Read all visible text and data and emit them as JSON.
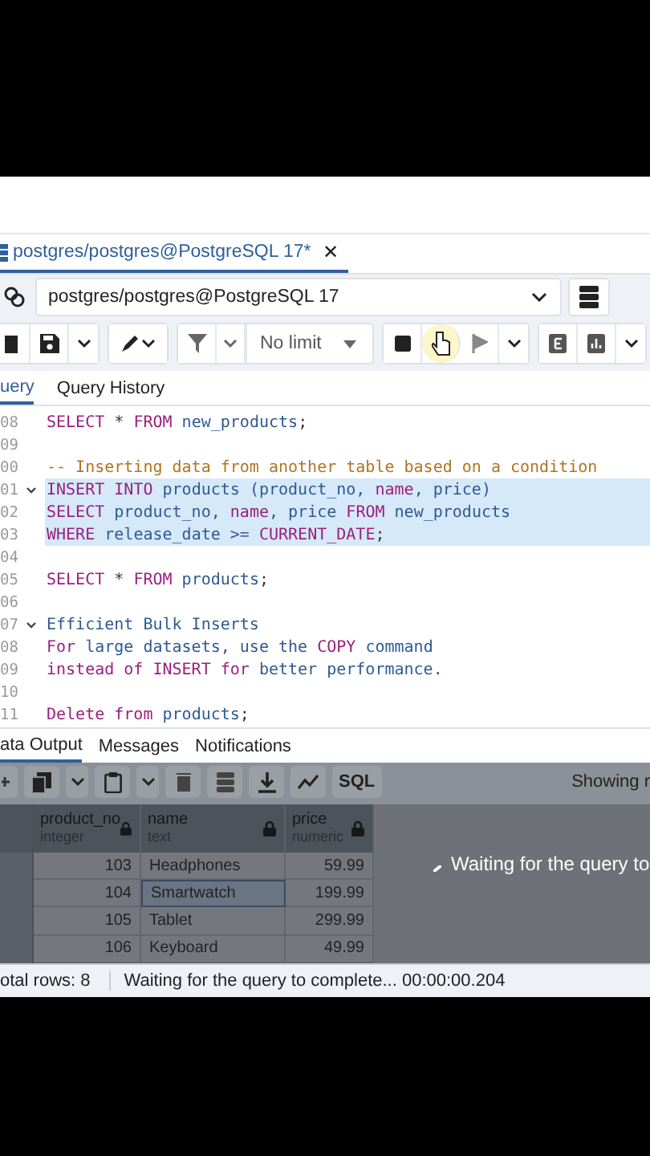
{
  "editor_tab": {
    "title": "postgres/postgres@PostgreSQL 17*",
    "close": "✕"
  },
  "connection": {
    "value": "postgres/postgres@PostgreSQL 17"
  },
  "toolbar": {
    "limit": "No limit"
  },
  "query_tabs": [
    {
      "label": "uery",
      "selected": true
    },
    {
      "label": "Query History",
      "selected": false
    }
  ],
  "code_lines": [
    {
      "number": "08",
      "selected": false,
      "foldable": false,
      "tokens": [
        {
          "text": "SELECT",
          "kind": "keyword"
        },
        {
          "text": " * ",
          "kind": "plain"
        },
        {
          "text": "FROM",
          "kind": "keyword"
        },
        {
          "text": " new_products",
          "kind": "ident"
        },
        {
          "text": ";",
          "kind": "plain"
        }
      ]
    },
    {
      "number": "09",
      "selected": false,
      "foldable": false
    },
    {
      "number": "00",
      "selected": false,
      "foldable": false,
      "tokens": [
        {
          "text": "-- Inserting data from another table based on a condition",
          "kind": "comment"
        }
      ]
    },
    {
      "number": "01",
      "selected": true,
      "foldable": true,
      "tokens": [
        {
          "text": "INSERT INTO",
          "kind": "keyword"
        },
        {
          "text": " products (product_no, ",
          "kind": "ident"
        },
        {
          "text": "name",
          "kind": "keyword"
        },
        {
          "text": ", price)",
          "kind": "ident"
        }
      ]
    },
    {
      "number": "02",
      "selected": true,
      "foldable": false,
      "tokens": [
        {
          "text": "SELECT",
          "kind": "keyword"
        },
        {
          "text": " product_no, ",
          "kind": "ident"
        },
        {
          "text": "name",
          "kind": "keyword"
        },
        {
          "text": ", price ",
          "kind": "ident"
        },
        {
          "text": "FROM",
          "kind": "keyword"
        },
        {
          "text": " new_products",
          "kind": "ident"
        }
      ]
    },
    {
      "number": "03",
      "selected": true,
      "foldable": false,
      "tokens": [
        {
          "text": "WHERE",
          "kind": "keyword"
        },
        {
          "text": " release_date >= ",
          "kind": "ident"
        },
        {
          "text": "CURRENT_DATE",
          "kind": "keyword"
        },
        {
          "text": ";",
          "kind": "plain"
        }
      ]
    },
    {
      "number": "04",
      "selected": false,
      "foldable": false
    },
    {
      "number": "05",
      "selected": false,
      "foldable": false,
      "tokens": [
        {
          "text": "SELECT",
          "kind": "keyword"
        },
        {
          "text": " * ",
          "kind": "plain"
        },
        {
          "text": "FROM",
          "kind": "keyword"
        },
        {
          "text": " products",
          "kind": "ident"
        },
        {
          "text": ";",
          "kind": "plain"
        }
      ]
    },
    {
      "number": "06",
      "selected": false,
      "foldable": false
    },
    {
      "number": "07",
      "selected": false,
      "foldable": true,
      "tokens": [
        {
          "text": "Efficient Bulk Inserts",
          "kind": "ident"
        }
      ]
    },
    {
      "number": "08",
      "selected": false,
      "foldable": false,
      "tokens": [
        {
          "text": "For",
          "kind": "keyword"
        },
        {
          "text": " large datasets, use the ",
          "kind": "ident"
        },
        {
          "text": "COPY",
          "kind": "keyword"
        },
        {
          "text": " command",
          "kind": "ident"
        }
      ]
    },
    {
      "number": "09",
      "selected": false,
      "foldable": false,
      "tokens": [
        {
          "text": "instead of INSERT for",
          "kind": "keyword"
        },
        {
          "text": " better performance.",
          "kind": "ident"
        }
      ]
    },
    {
      "number": "10",
      "selected": false,
      "foldable": false
    },
    {
      "number": "11",
      "selected": false,
      "foldable": false,
      "tokens": [
        {
          "text": "Delete from",
          "kind": "keyword"
        },
        {
          "text": " products",
          "kind": "ident"
        },
        {
          "text": ";",
          "kind": "plain"
        }
      ]
    }
  ],
  "result_tabs": [
    {
      "label": "ata Output",
      "selected": true
    },
    {
      "label": "Messages",
      "selected": false
    },
    {
      "label": "Notifications",
      "selected": false
    }
  ],
  "result_toolbar": {
    "sql": "SQL",
    "showing": "Showing r"
  },
  "grid": {
    "columns": [
      {
        "name": "product_no",
        "type": "integer"
      },
      {
        "name": "name",
        "type": "text"
      },
      {
        "name": "price",
        "type": "numeric"
      }
    ],
    "rows": [
      {
        "cells": [
          {
            "text": "103",
            "selected": false
          },
          {
            "text": "Headphones",
            "selected": false
          },
          {
            "text": "59.99",
            "selected": false
          }
        ]
      },
      {
        "cells": [
          {
            "text": "104",
            "selected": false
          },
          {
            "text": "Smartwatch",
            "selected": true
          },
          {
            "text": "199.99",
            "selected": false
          }
        ]
      },
      {
        "cells": [
          {
            "text": "105",
            "selected": false
          },
          {
            "text": "Tablet",
            "selected": false
          },
          {
            "text": "299.99",
            "selected": false
          }
        ]
      },
      {
        "cells": [
          {
            "text": "106",
            "selected": false
          },
          {
            "text": "Keyboard",
            "selected": false
          },
          {
            "text": "49.99",
            "selected": false
          }
        ]
      }
    ]
  },
  "loading": {
    "message": "Waiting for the query to"
  },
  "status": {
    "total": "otal rows: 8",
    "message": "Waiting for the query to complete... 00:00:00.204"
  }
}
